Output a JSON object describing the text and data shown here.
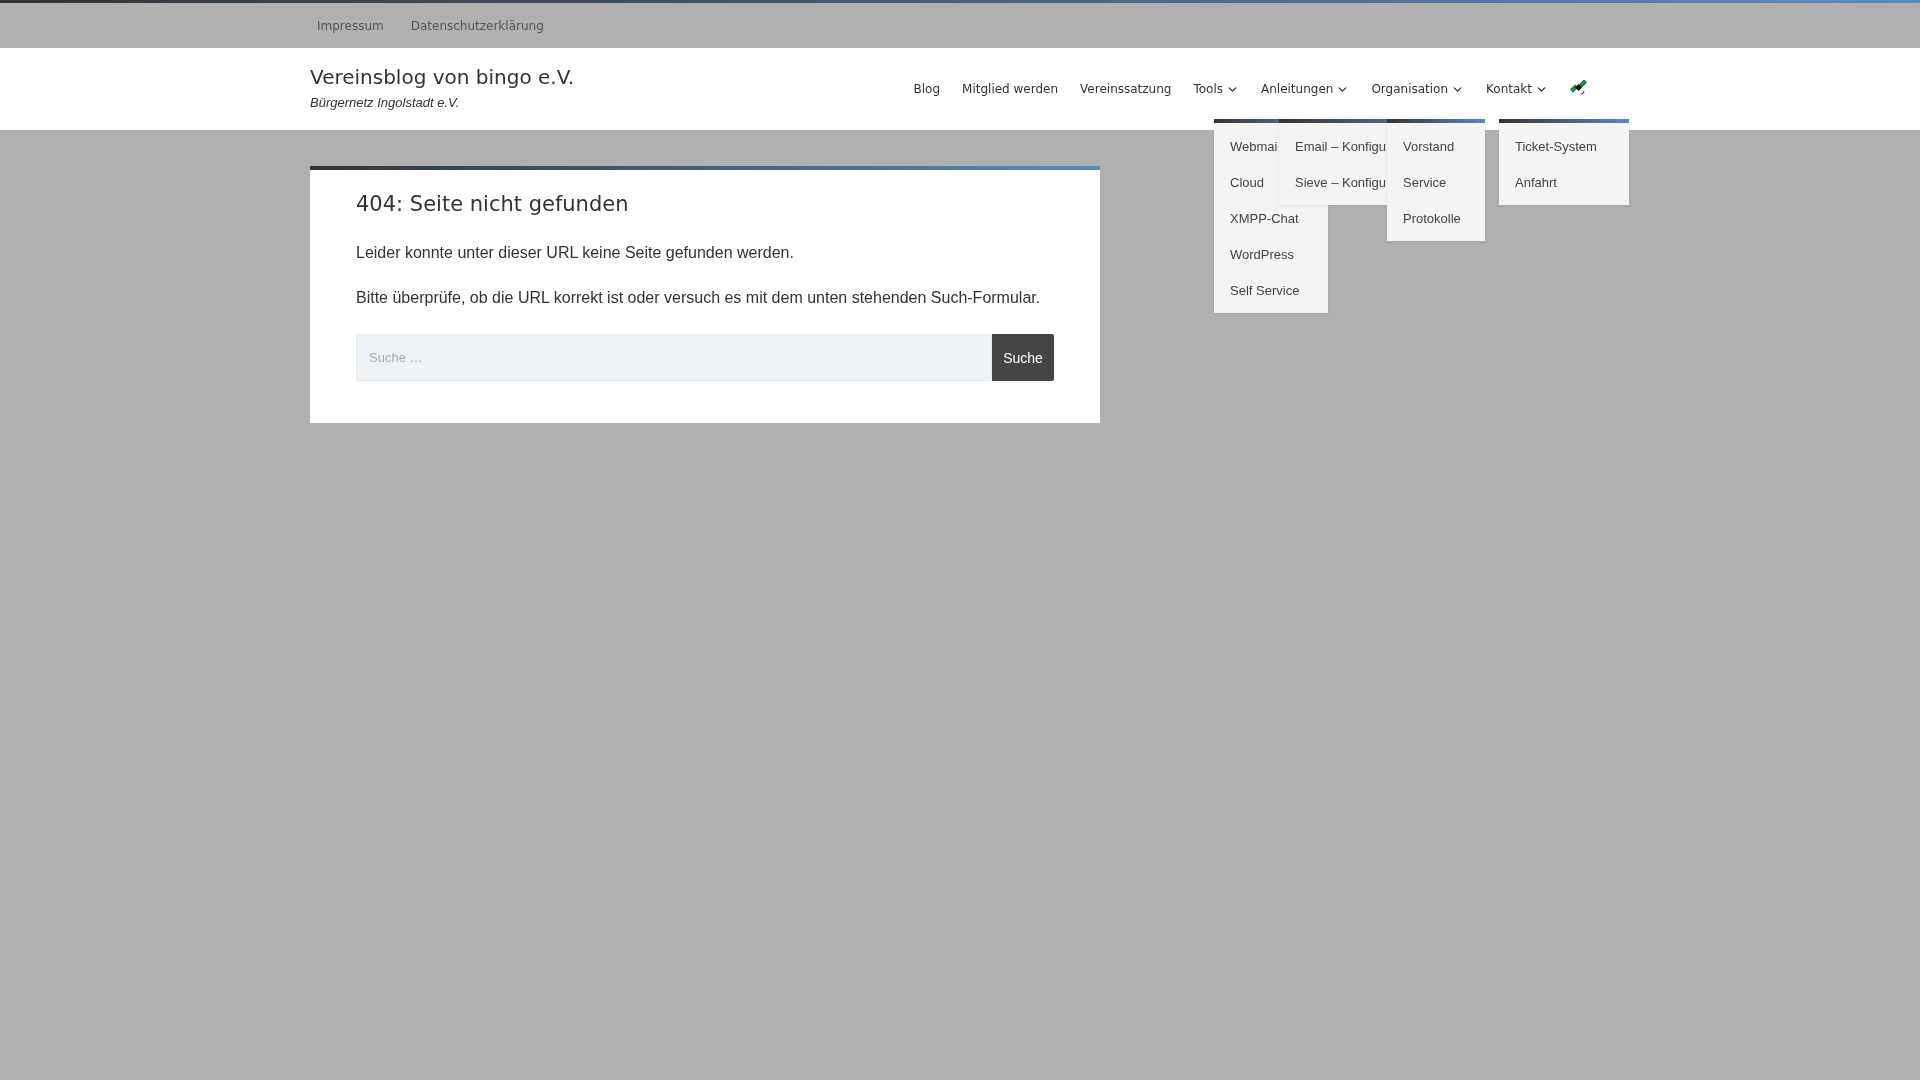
{
  "top_bar": {
    "links": [
      "Impressum",
      "Datenschutzerklärung"
    ]
  },
  "header": {
    "site_title": "Vereinsblog von bingo e.V.",
    "tagline": "Bürgernetz Ingolstadt e.V."
  },
  "nav": [
    {
      "label": "Blog",
      "has_submenu": false
    },
    {
      "label": "Mitglied werden",
      "has_submenu": false
    },
    {
      "label": "Vereinssatzung",
      "has_submenu": false
    },
    {
      "label": "Tools",
      "has_submenu": true,
      "submenu": [
        "Webmai",
        "Cloud",
        "XMPP-Chat",
        "WordPress",
        "Self Service"
      ]
    },
    {
      "label": "Anleitungen",
      "has_submenu": true,
      "submenu": [
        "Email – Konfigu",
        "Sieve – Konfigu"
      ]
    },
    {
      "label": "Organisation",
      "has_submenu": true,
      "submenu": [
        "Vorstand",
        "Service",
        "Protokolle"
      ]
    },
    {
      "label": "Kontakt",
      "has_submenu": true,
      "submenu": [
        "Ticket-System",
        "Anfahrt"
      ]
    }
  ],
  "article": {
    "title": "404: Seite nicht gefunden",
    "paragraphs": [
      "Leider konnte unter dieser URL keine Seite gefunden werden.",
      "Bitte überprüfe, ob die URL korrekt ist oder versuch es mit dem unten stehenden Such-Formular."
    ],
    "search": {
      "placeholder": "Suche …",
      "button": "Suche"
    }
  }
}
